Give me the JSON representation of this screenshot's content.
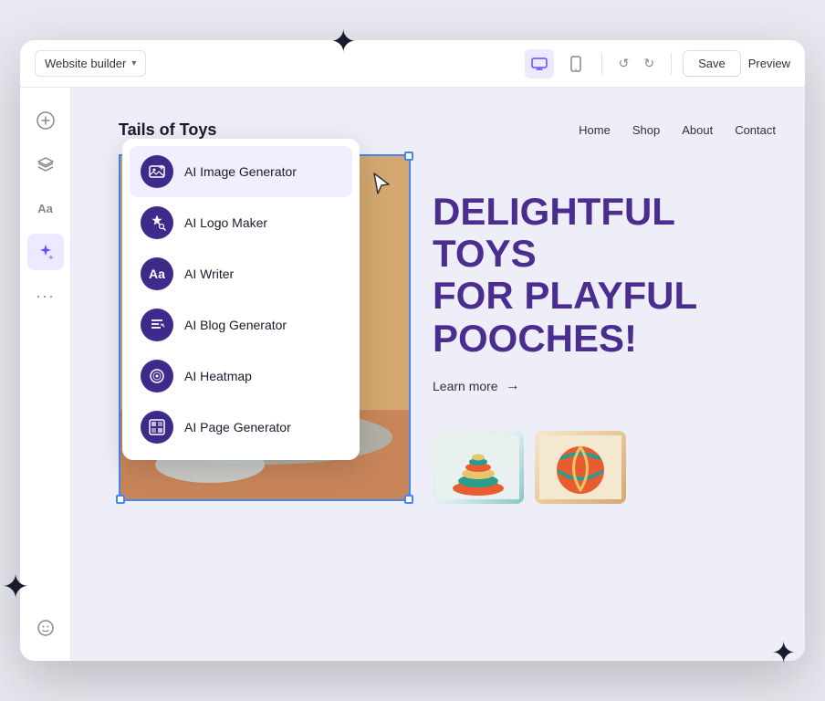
{
  "browser": {
    "title": "Website builder",
    "title_chevron": "▾",
    "save_label": "Save",
    "preview_label": "Preview"
  },
  "sidebar": {
    "items": [
      {
        "name": "add-icon",
        "label": "Add",
        "icon": "✦",
        "active": false
      },
      {
        "name": "layers-icon",
        "label": "Layers",
        "icon": "◈",
        "active": false
      },
      {
        "name": "text-icon",
        "label": "Text",
        "icon": "Aa",
        "active": false
      },
      {
        "name": "ai-icon",
        "label": "AI",
        "icon": "✦",
        "active": true
      },
      {
        "name": "more-icon",
        "label": "More",
        "icon": "···",
        "active": false
      }
    ],
    "bottom": [
      {
        "name": "emoji-icon",
        "label": "Emoji",
        "icon": "☺"
      }
    ]
  },
  "site": {
    "logo": "Tails of Toys",
    "nav": {
      "links": [
        "Home",
        "Shop",
        "About",
        "Contact"
      ]
    },
    "hero": {
      "heading_line1": "DELIGHTFUL TOYS",
      "heading_line2": "FOR PLAYFUL",
      "heading_line3": "POOCHES!",
      "learn_more": "Learn more",
      "learn_more_arrow": "→"
    }
  },
  "dropdown": {
    "items": [
      {
        "id": "ai-image",
        "label": "AI Image Generator",
        "icon": "🖼",
        "active": true
      },
      {
        "id": "ai-logo",
        "label": "AI Logo Maker",
        "icon": "✦"
      },
      {
        "id": "ai-writer",
        "label": "AI Writer",
        "icon": "Aa"
      },
      {
        "id": "ai-blog",
        "label": "AI Blog Generator",
        "icon": "✎"
      },
      {
        "id": "ai-heatmap",
        "label": "AI Heatmap",
        "icon": "◎"
      },
      {
        "id": "ai-page",
        "label": "AI Page Generator",
        "icon": "▦"
      }
    ]
  },
  "sparkles": {
    "top": "✦",
    "left_bottom": "✦",
    "right_bottom": "✦",
    "small": "✦"
  },
  "colors": {
    "purple_dark": "#4a2d8f",
    "purple_accent": "#6c47ff",
    "purple_light": "#eeeef8",
    "menu_bg": "#3d2a8a"
  }
}
